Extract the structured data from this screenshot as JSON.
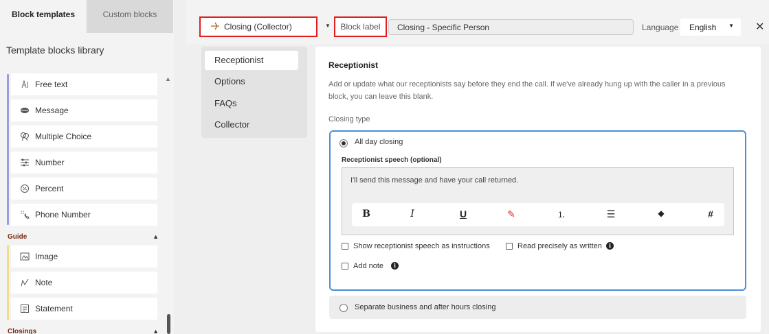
{
  "left_panel": {
    "tabs": [
      {
        "label": "Block templates"
      },
      {
        "label": "Custom blocks"
      }
    ],
    "library_title": "Template blocks library",
    "groups": [
      {
        "name": "",
        "bar_color": "#9b9be0",
        "items": [
          {
            "label": "Free text",
            "icon": "free-text-icon"
          },
          {
            "label": "Message",
            "icon": "message-icon"
          },
          {
            "label": "Multiple Choice",
            "icon": "multiple-choice-icon"
          },
          {
            "label": "Number",
            "icon": "number-icon"
          },
          {
            "label": "Percent",
            "icon": "percent-icon"
          },
          {
            "label": "Phone Number",
            "icon": "phone-number-icon"
          }
        ]
      },
      {
        "name": "Guide",
        "bar_color": "#f4dc8a",
        "items": [
          {
            "label": "Image",
            "icon": "image-icon"
          },
          {
            "label": "Note",
            "icon": "note-icon"
          },
          {
            "label": "Statement",
            "icon": "statement-icon"
          }
        ]
      },
      {
        "name": "Closings",
        "bar_color": "#f4dc8a",
        "items": []
      }
    ]
  },
  "topbar": {
    "block_select": {
      "value": "Closing (Collector)",
      "icon": "closing-icon"
    },
    "block_label_tag": "Block label",
    "block_label_value": "Closing - Specific Person",
    "language_label": "Language",
    "language_value": "English",
    "close_icon": "close-icon"
  },
  "nav": {
    "items": [
      {
        "label": "Receptionist",
        "active": true
      },
      {
        "label": "Options",
        "active": false
      },
      {
        "label": "FAQs",
        "active": false
      },
      {
        "label": "Collector",
        "active": false
      }
    ]
  },
  "main": {
    "title": "Receptionist",
    "description": "Add or update what our receptionists say before they end the call. If we've already hung up with the caller in a previous block, you can leave this blank.",
    "closing_type_label": "Closing type",
    "option_all_day": {
      "label": "All day closing",
      "checked": true
    },
    "speech_label": "Receptionist speech (optional)",
    "speech_text": "I'll send this message and have your call returned.",
    "format_buttons": [
      {
        "glyph": "B",
        "icon": "bold-icon"
      },
      {
        "glyph": "I",
        "icon": "italic-icon"
      },
      {
        "glyph": "U",
        "icon": "underline-icon"
      },
      {
        "glyph": "✎",
        "icon": "highlight-icon"
      },
      {
        "glyph": "⒈",
        "icon": "ordered-list-icon"
      },
      {
        "glyph": "☰",
        "icon": "bullet-list-icon"
      },
      {
        "glyph": "◆",
        "icon": "eraser-icon"
      },
      {
        "glyph": "#",
        "icon": "hash-icon"
      }
    ],
    "checkbox_instructions": {
      "label": "Show receptionist speech as instructions",
      "checked": false
    },
    "checkbox_precise": {
      "label": "Read precisely as written",
      "checked": false
    },
    "checkbox_note": {
      "label": "Add note",
      "checked": false
    },
    "option_separate": {
      "label": "Separate business and after hours closing",
      "checked": false
    }
  }
}
